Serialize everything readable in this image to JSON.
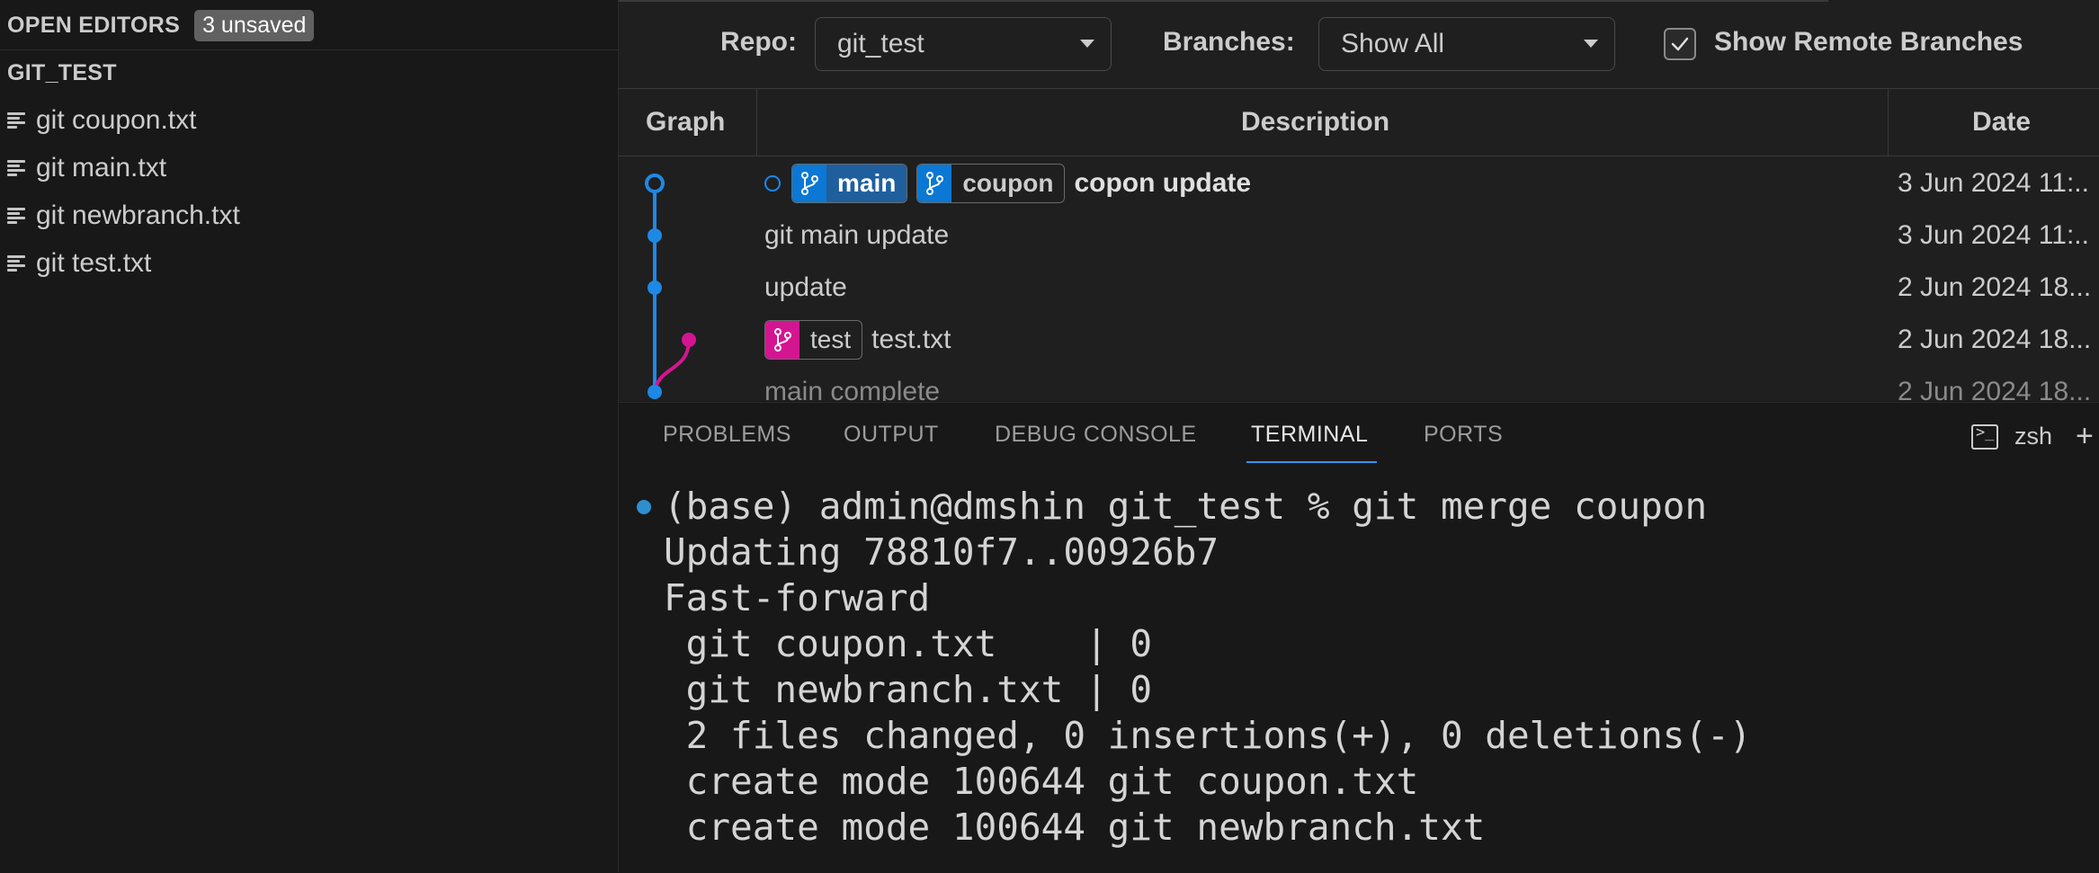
{
  "sidebar": {
    "open_editors_title": "OPEN EDITORS",
    "unsaved_badge": "3 unsaved",
    "folder_title": "GIT_TEST",
    "files": [
      {
        "name": "git coupon.txt"
      },
      {
        "name": "git main.txt"
      },
      {
        "name": "git newbranch.txt"
      },
      {
        "name": "git test.txt"
      }
    ]
  },
  "git_graph": {
    "repo_label": "Repo:",
    "repo_value": "git_test",
    "branches_label": "Branches:",
    "branches_value": "Show All",
    "show_remote_label": "Show Remote Branches",
    "show_remote_checked": true,
    "columns": {
      "graph": "Graph",
      "description": "Description",
      "date": "Date"
    },
    "commits": [
      {
        "refs": [
          "main",
          "coupon"
        ],
        "message": "copon update",
        "date": "3 Jun 2024 11:..",
        "uncommitted_marker": true
      },
      {
        "refs": [],
        "message": "git main update",
        "date": "3 Jun 2024 11:.."
      },
      {
        "refs": [],
        "message": "update",
        "date": "2 Jun 2024 18..."
      },
      {
        "refs": [
          "test"
        ],
        "message": "test.txt",
        "date": "2 Jun 2024 18..."
      },
      {
        "refs": [],
        "message": "main complete",
        "date": "2 Jun 2024 18..."
      }
    ],
    "colors": {
      "branch_main": "#1e88e5",
      "branch_test": "#d41591"
    }
  },
  "panel": {
    "tabs": [
      "PROBLEMS",
      "OUTPUT",
      "DEBUG CONSOLE",
      "TERMINAL",
      "PORTS"
    ],
    "active_tab": "TERMINAL",
    "shell": "zsh",
    "terminal_lines": [
      "(base) admin@dmshin git_test % git merge coupon",
      "Updating 78810f7..00926b7",
      "Fast-forward",
      " git coupon.txt    | 0",
      " git newbranch.txt | 0",
      " 2 files changed, 0 insertions(+), 0 deletions(-)",
      " create mode 100644 git coupon.txt",
      " create mode 100644 git newbranch.txt"
    ]
  }
}
